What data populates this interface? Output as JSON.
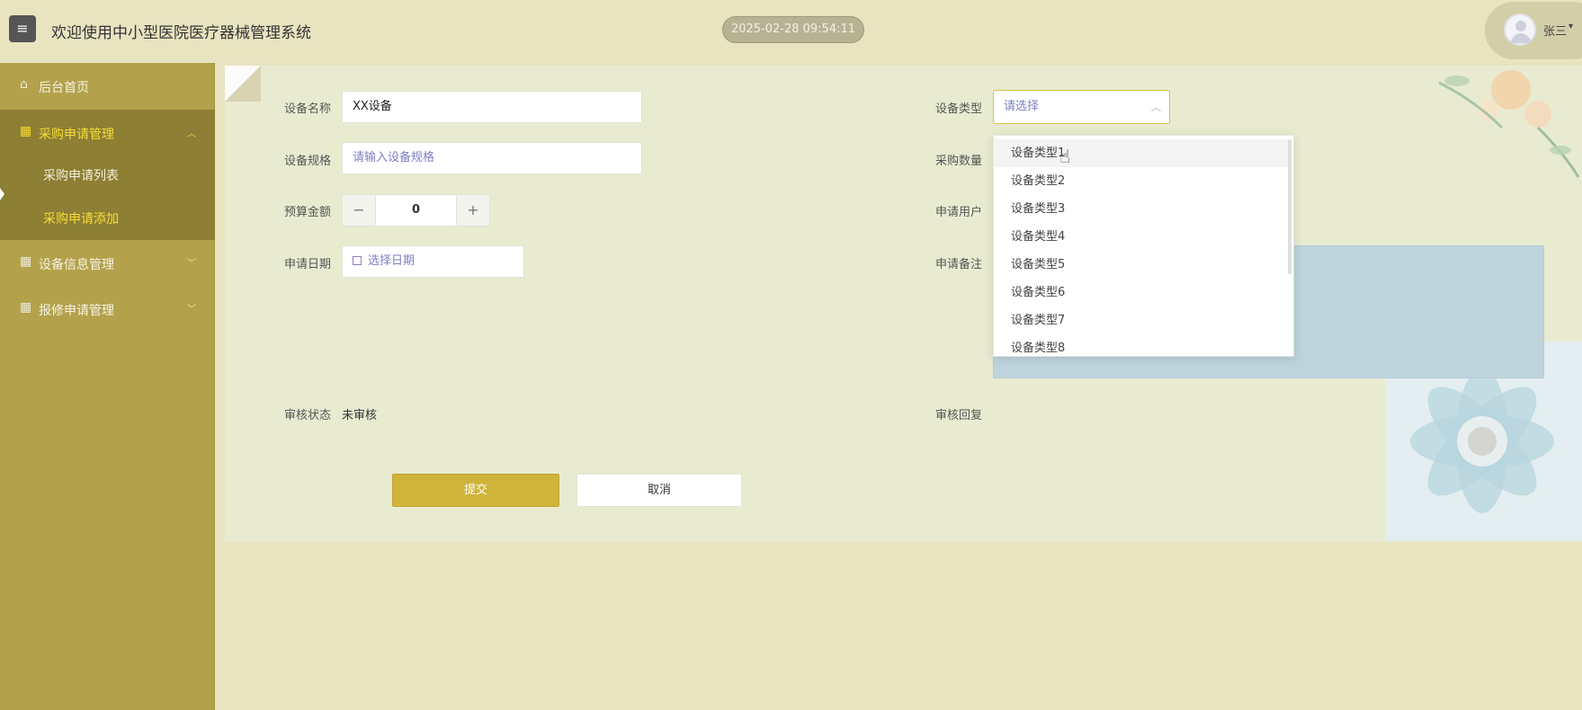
{
  "header": {
    "menu_icon": "hamburger-icon",
    "title": "欢迎使用中小型医院医疗器械管理系统",
    "datetime": "2025-02-28 09:54:11",
    "user_name": "张三",
    "user_caret": "chevron-down-icon"
  },
  "sidebar": {
    "items": [
      {
        "label": "后台首页",
        "icon": "home-icon"
      },
      {
        "label": "采购申请管理",
        "icon": "grid-icon",
        "expanded": true,
        "children": [
          {
            "label": "采购申请列表"
          },
          {
            "label": "采购申请添加",
            "active": true
          }
        ]
      },
      {
        "label": "设备信息管理",
        "icon": "grid-icon"
      },
      {
        "label": "报修申请管理",
        "icon": "grid-icon"
      }
    ]
  },
  "form": {
    "device_name": {
      "label": "设备名称",
      "value": "XX设备"
    },
    "device_spec": {
      "label": "设备规格",
      "placeholder": "请输入设备规格"
    },
    "budget": {
      "label": "预算金额",
      "value": "0",
      "minus": "−",
      "plus": "+"
    },
    "apply_date": {
      "label": "申请日期",
      "placeholder": "选择日期"
    },
    "device_type": {
      "label": "设备类型",
      "placeholder": "请选择"
    },
    "quantity": {
      "label": "采购数量"
    },
    "apply_user": {
      "label": "申请用户"
    },
    "remark": {
      "label": "申请备注"
    },
    "audit_status": {
      "label": "审核状态",
      "value": "未审核"
    },
    "audit_reply": {
      "label": "审核回复"
    },
    "submit": "提交",
    "cancel": "取消"
  },
  "dropdown": {
    "options": [
      "设备类型1",
      "设备类型2",
      "设备类型3",
      "设备类型4",
      "设备类型5",
      "设备类型6",
      "设备类型7",
      "设备类型8"
    ],
    "hovered_index": 0
  },
  "colors": {
    "sidebar": "#b3a24b",
    "sidebar_open": "#8d7f33",
    "active_text": "#f7dc3a",
    "primary_button": "#cfb43a",
    "background": "#e8e4c0"
  }
}
